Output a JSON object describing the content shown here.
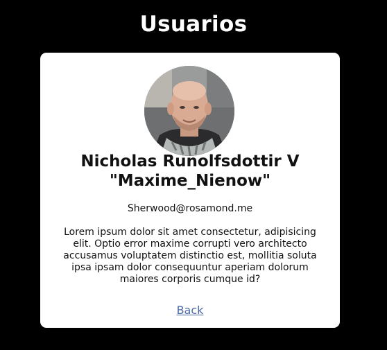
{
  "header": {
    "title": "Usuarios"
  },
  "profile": {
    "name_line1": "Nicholas Runolfsdottir V",
    "name_line2": "\"Maxime_Nienow\"",
    "email": "Sherwood@rosamond.me",
    "bio": "Lorem ipsum dolor sit amet consectetur, adipisicing elit. Optio error maxime corrupti vero architecto accusamus voluptatem distinctio est, mollitia soluta ipsa ipsam dolor consequuntur aperiam dolorum maiores corporis cumque id?",
    "avatar_icon": "user-photo"
  },
  "actions": {
    "back_label": "Back"
  },
  "colors": {
    "background": "#000000",
    "card": "#ffffff",
    "link": "#4a6aa8"
  }
}
